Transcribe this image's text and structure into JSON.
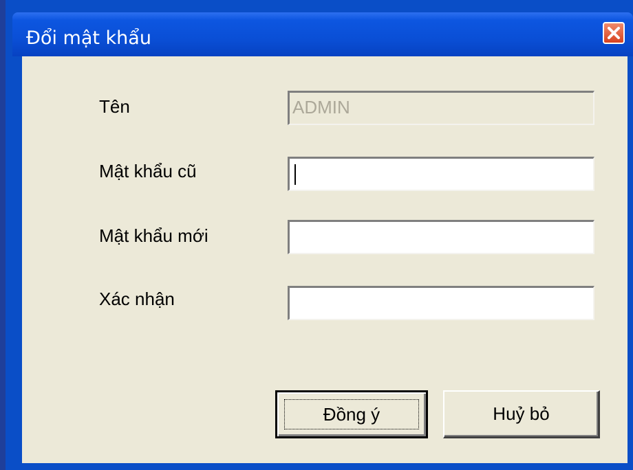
{
  "window": {
    "title": "Đổi mật khẩu",
    "close_label": "Close"
  },
  "form": {
    "name_label": "Tên",
    "name_value": "ADMIN",
    "old_password_label": "Mật khẩu cũ",
    "old_password_value": "",
    "new_password_label": "Mật khẩu mới",
    "new_password_value": "",
    "confirm_label": "Xác nhận",
    "confirm_value": ""
  },
  "buttons": {
    "ok_label": "Đồng ý",
    "cancel_label": "Huỷ bỏ"
  },
  "colors": {
    "titlebar": "#0a4fd6",
    "client": "#ece9d8",
    "close": "#d8421f"
  }
}
